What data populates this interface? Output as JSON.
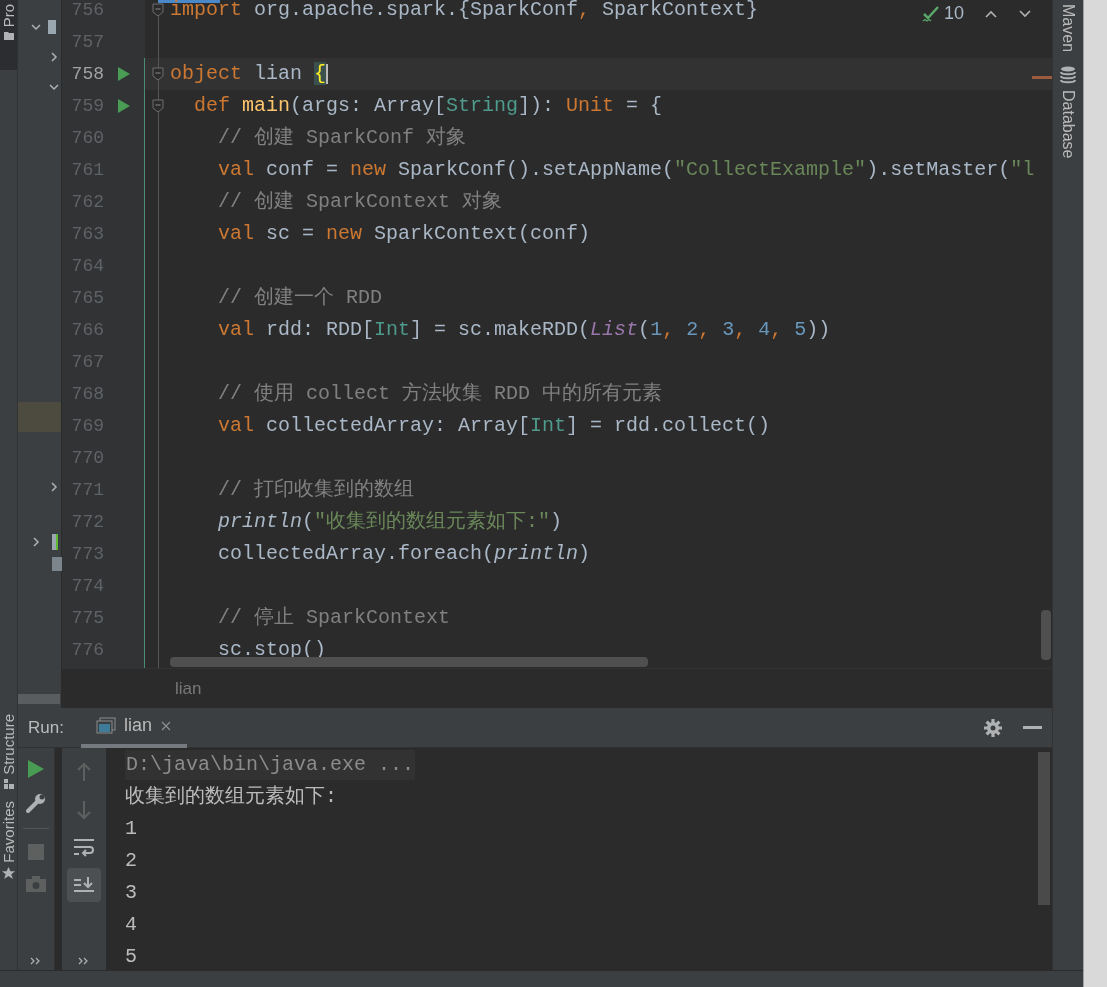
{
  "left_strip": {
    "tabs": [
      "Pro"
    ]
  },
  "editor": {
    "inspection_count": "10",
    "lines": [
      {
        "number": "756",
        "kind": "normal",
        "icons": [
          {
            "kind": "fold"
          }
        ],
        "tokens": [
          {
            "text": "import",
            "kind": "keyword"
          },
          {
            "text": " org.apache.spark.{SparkConf",
            "kind": "plain"
          },
          {
            "text": ",",
            "kind": "keyword"
          },
          {
            "text": " SparkContext}",
            "kind": "plain"
          }
        ]
      },
      {
        "number": "757",
        "kind": "normal"
      },
      {
        "number": "758",
        "kind": "current",
        "icons": [
          {
            "kind": "run"
          },
          {
            "kind": "fold"
          }
        ],
        "tokens": [
          {
            "text": "object",
            "kind": "keyword"
          },
          {
            "text": " lian ",
            "kind": "plain"
          },
          {
            "text": "{",
            "kind": "brace"
          }
        ]
      },
      {
        "number": "759",
        "kind": "normal",
        "icons": [
          {
            "kind": "run"
          },
          {
            "kind": "fold"
          }
        ],
        "tokens": [
          {
            "text": "  def ",
            "kind": "keyword"
          },
          {
            "text": "main",
            "kind": "function"
          },
          {
            "text": "(args: Array[",
            "kind": "plain"
          },
          {
            "text": "String",
            "kind": "type"
          },
          {
            "text": "]): ",
            "kind": "plain"
          },
          {
            "text": "Unit",
            "kind": "keyword"
          },
          {
            "text": " = {",
            "kind": "plain"
          }
        ]
      },
      {
        "number": "760",
        "kind": "normal",
        "tokens": [
          {
            "text": "    // 创建 SparkConf 对象",
            "kind": "comment"
          }
        ]
      },
      {
        "number": "761",
        "kind": "normal",
        "tokens": [
          {
            "text": "    val",
            "kind": "keyword"
          },
          {
            "text": " conf = ",
            "kind": "plain"
          },
          {
            "text": "new",
            "kind": "keyword"
          },
          {
            "text": " SparkConf().setAppName(",
            "kind": "plain"
          },
          {
            "text": "\"CollectExample\"",
            "kind": "string"
          },
          {
            "text": ").setMaster(",
            "kind": "plain"
          },
          {
            "text": "\"l",
            "kind": "string"
          }
        ]
      },
      {
        "number": "762",
        "kind": "normal",
        "tokens": [
          {
            "text": "    // 创建 SparkContext 对象",
            "kind": "comment"
          }
        ]
      },
      {
        "number": "763",
        "kind": "normal",
        "tokens": [
          {
            "text": "    val",
            "kind": "keyword"
          },
          {
            "text": " sc = ",
            "kind": "plain"
          },
          {
            "text": "new",
            "kind": "keyword"
          },
          {
            "text": " SparkContext(conf)",
            "kind": "plain"
          }
        ]
      },
      {
        "number": "764",
        "kind": "normal"
      },
      {
        "number": "765",
        "kind": "normal",
        "tokens": [
          {
            "text": "    // 创建一个 RDD",
            "kind": "comment"
          }
        ]
      },
      {
        "number": "766",
        "kind": "normal",
        "tokens": [
          {
            "text": "    val",
            "kind": "keyword"
          },
          {
            "text": " rdd: RDD[",
            "kind": "plain"
          },
          {
            "text": "Int",
            "kind": "type"
          },
          {
            "text": "] = sc.makeRDD(",
            "kind": "plain"
          },
          {
            "text": "List",
            "kind": "object"
          },
          {
            "text": "(",
            "kind": "plain"
          },
          {
            "text": "1",
            "kind": "number"
          },
          {
            "text": ", ",
            "kind": "keyword"
          },
          {
            "text": "2",
            "kind": "number"
          },
          {
            "text": ", ",
            "kind": "keyword"
          },
          {
            "text": "3",
            "kind": "number"
          },
          {
            "text": ", ",
            "kind": "keyword"
          },
          {
            "text": "4",
            "kind": "number"
          },
          {
            "text": ", ",
            "kind": "keyword"
          },
          {
            "text": "5",
            "kind": "number"
          },
          {
            "text": "))",
            "kind": "plain"
          }
        ]
      },
      {
        "number": "767",
        "kind": "normal"
      },
      {
        "number": "768",
        "kind": "normal",
        "tokens": [
          {
            "text": "    // 使用 collect 方法收集 RDD 中的所有元素",
            "kind": "comment"
          }
        ]
      },
      {
        "number": "769",
        "kind": "normal",
        "tokens": [
          {
            "text": "    val",
            "kind": "keyword"
          },
          {
            "text": " collectedArray: Array[",
            "kind": "plain"
          },
          {
            "text": "Int",
            "kind": "type"
          },
          {
            "text": "] = rdd.collect()",
            "kind": "plain"
          }
        ]
      },
      {
        "number": "770",
        "kind": "normal"
      },
      {
        "number": "771",
        "kind": "normal",
        "tokens": [
          {
            "text": "    // 打印收集到的数组",
            "kind": "comment"
          }
        ]
      },
      {
        "number": "772",
        "kind": "normal",
        "tokens": [
          {
            "text": "    println",
            "kind": "call"
          },
          {
            "text": "(",
            "kind": "plain"
          },
          {
            "text": "\"收集到的数组元素如下:\"",
            "kind": "string"
          },
          {
            "text": ")",
            "kind": "plain"
          }
        ]
      },
      {
        "number": "773",
        "kind": "normal",
        "tokens": [
          {
            "text": "    collectedArray.foreach(",
            "kind": "plain"
          },
          {
            "text": "println",
            "kind": "call"
          },
          {
            "text": ")",
            "kind": "plain"
          }
        ]
      },
      {
        "number": "774",
        "kind": "normal"
      },
      {
        "number": "775",
        "kind": "normal",
        "tokens": [
          {
            "text": "    // 停止 SparkContext",
            "kind": "comment"
          }
        ]
      },
      {
        "number": "776",
        "kind": "normal",
        "tokens": [
          {
            "text": "    sc.stop()",
            "kind": "plain"
          }
        ]
      }
    ],
    "breadcrumb": "lian"
  },
  "right_strip": {
    "tabs": [
      {
        "label": "Maven",
        "kind": "text"
      },
      {
        "label": "Database",
        "kind": "database"
      }
    ]
  },
  "run_panel": {
    "label": "Run:",
    "tabs": [
      {
        "label": "lian",
        "selected": true
      }
    ],
    "console": [
      {
        "text": "D:\\java\\bin\\java.exe ...",
        "kind": "command"
      },
      {
        "text": "收集到的数组元素如下:",
        "kind": "output"
      },
      {
        "text": "1",
        "kind": "output"
      },
      {
        "text": "2",
        "kind": "output"
      },
      {
        "text": "3",
        "kind": "output"
      },
      {
        "text": "4",
        "kind": "output"
      },
      {
        "text": "5",
        "kind": "output"
      }
    ]
  },
  "bottom_left_strip": {
    "tabs": [
      {
        "label": "Structure",
        "kind": "structure"
      },
      {
        "label": "Favorites",
        "kind": "star"
      }
    ]
  }
}
